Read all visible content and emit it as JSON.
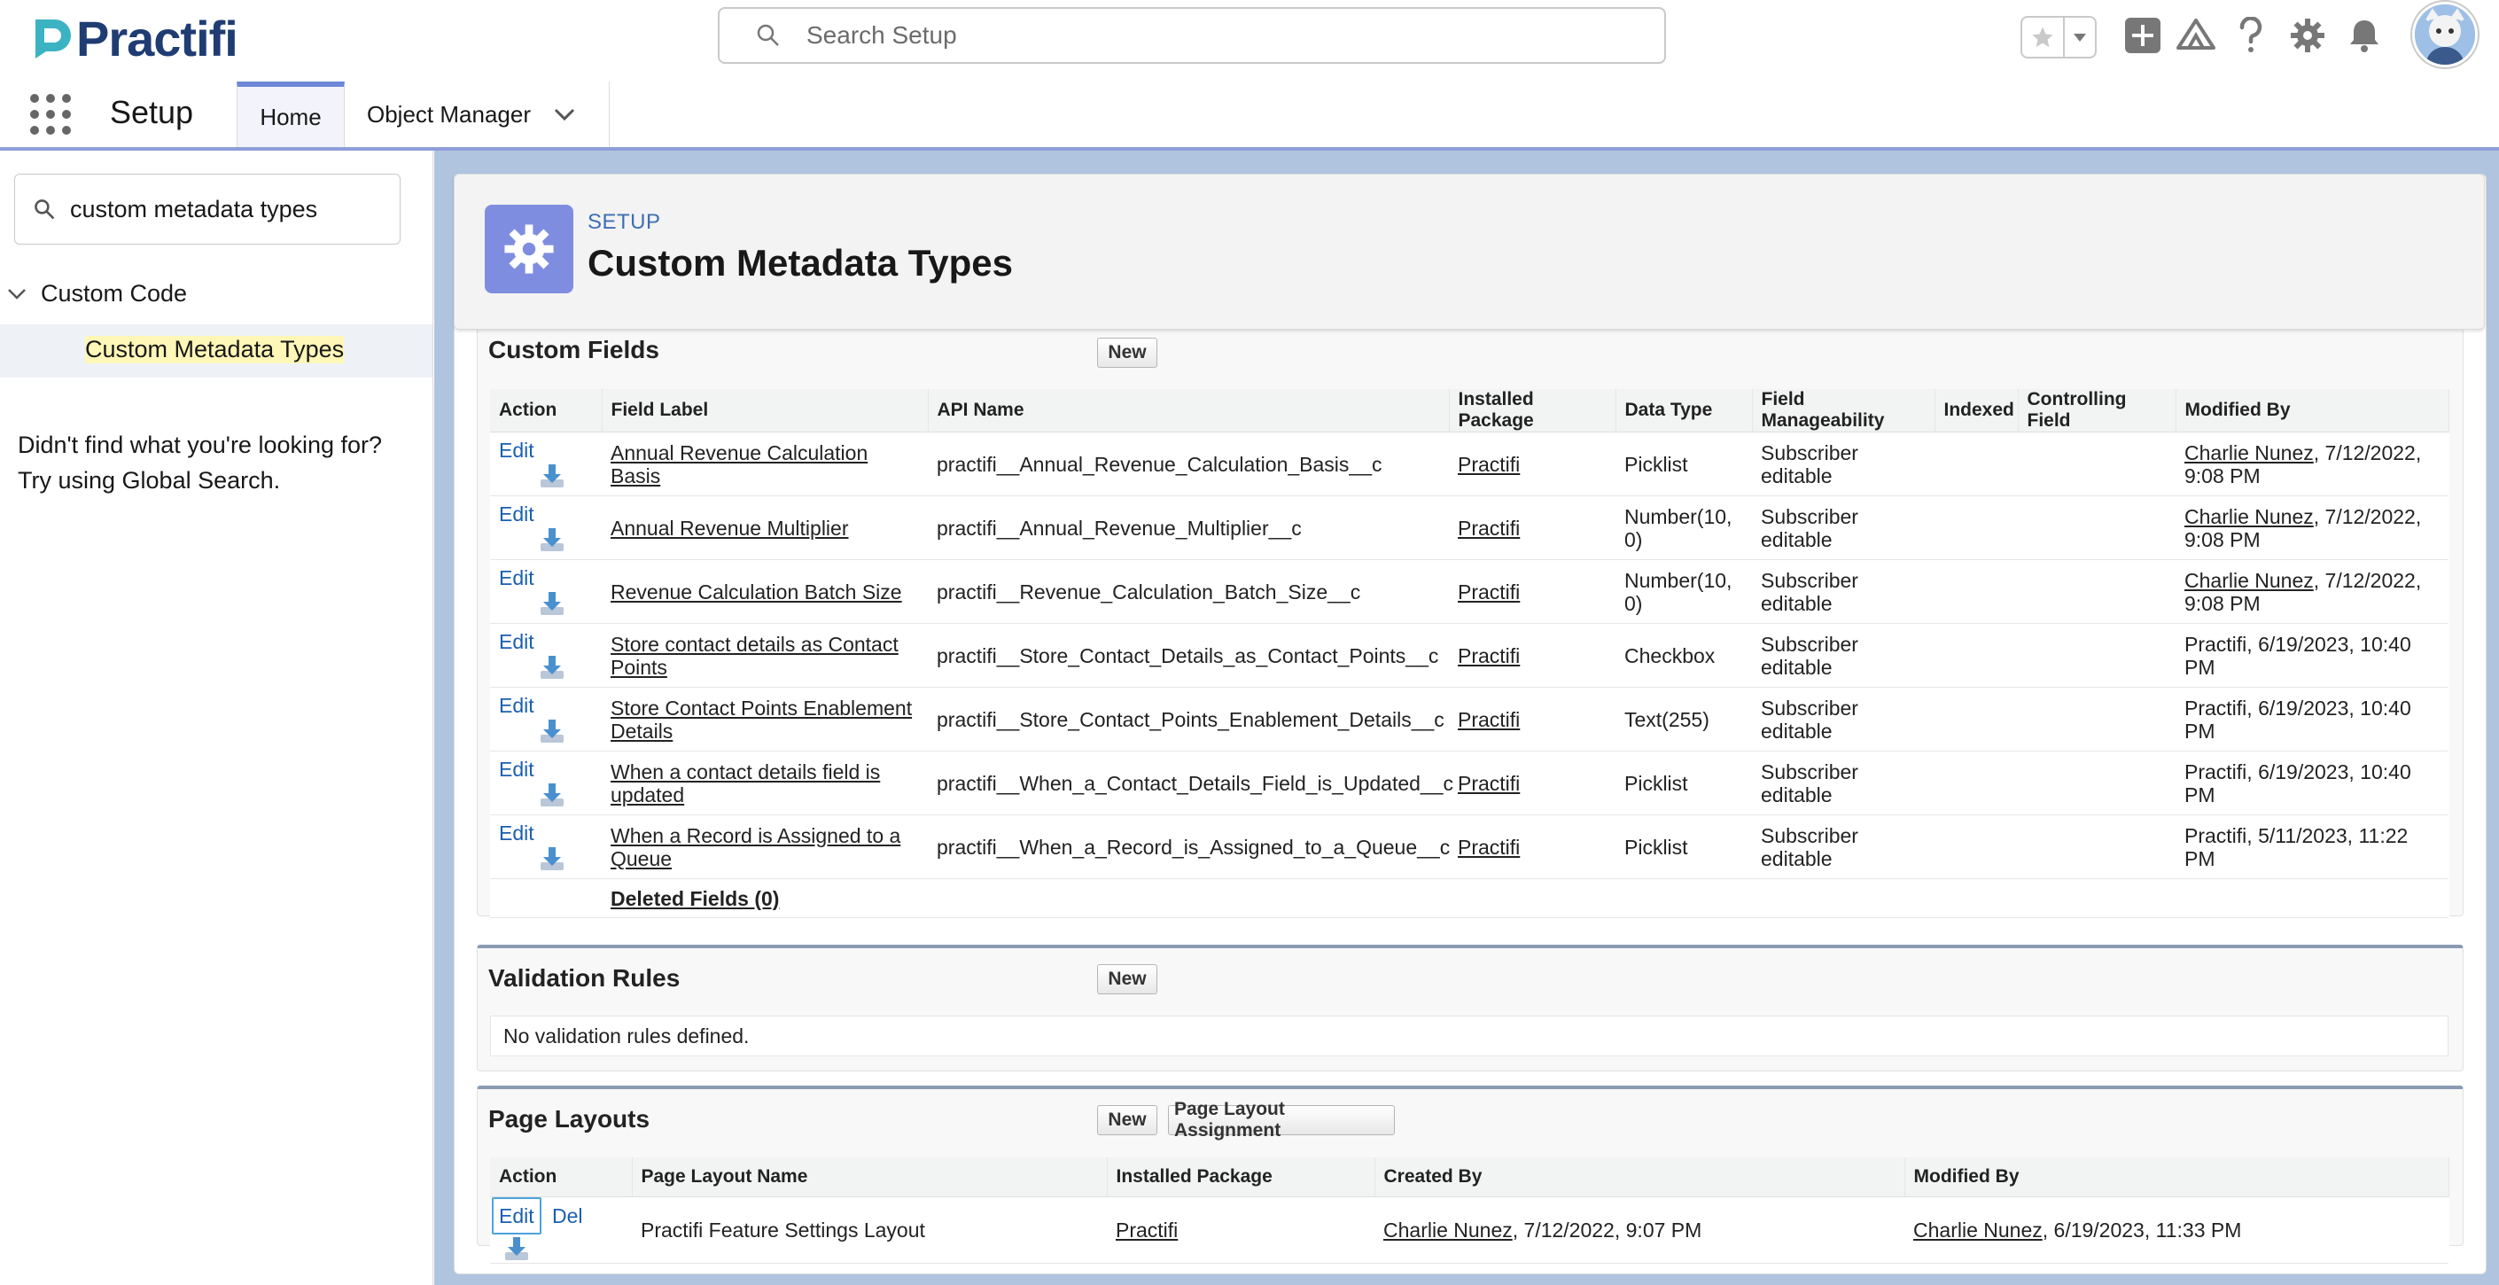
{
  "header": {
    "brand": "Practifi",
    "search_placeholder": "Search Setup"
  },
  "nav": {
    "app_name": "Setup",
    "tabs": [
      {
        "label": "Home"
      },
      {
        "label": "Object Manager"
      }
    ]
  },
  "sidebar": {
    "quick_find_value": "custom metadata types",
    "tree_parent": "Custom Code",
    "tree_child": "Custom Metadata Types",
    "help_text": "Didn't find what you're looking for? Try using Global Search."
  },
  "page_header": {
    "breadcrumb": "SETUP",
    "title": "Custom Metadata Types"
  },
  "custom_fields": {
    "partial_title": "Custom Fields",
    "new_label": "New",
    "columns": [
      "Action",
      "Field Label",
      "API Name",
      "Installed Package",
      "Data Type",
      "Field Manageability",
      "Indexed",
      "Controlling Field",
      "Modified By"
    ],
    "rows": [
      {
        "edit": "Edit",
        "label": "Annual Revenue Calculation Basis",
        "api": "practifi__Annual_Revenue_Calculation_Basis__c",
        "pkg": "Practifi",
        "type": "Picklist",
        "manage": "Subscriber editable",
        "mod_user": "Charlie Nunez",
        "mod_date": ", 7/12/2022, 9:08 PM"
      },
      {
        "edit": "Edit",
        "label": "Annual Revenue Multiplier",
        "api": "practifi__Annual_Revenue_Multiplier__c",
        "pkg": "Practifi",
        "type": "Number(10, 0)",
        "manage": "Subscriber editable",
        "mod_user": "Charlie Nunez",
        "mod_date": ", 7/12/2022, 9:08 PM"
      },
      {
        "edit": "Edit",
        "label": "Revenue Calculation Batch Size",
        "api": "practifi__Revenue_Calculation_Batch_Size__c",
        "pkg": "Practifi",
        "type": "Number(10, 0)",
        "manage": "Subscriber editable",
        "mod_user": "Charlie Nunez",
        "mod_date": ", 7/12/2022, 9:08 PM"
      },
      {
        "edit": "Edit",
        "label": "Store contact details as Contact Points",
        "api": "practifi__Store_Contact_Details_as_Contact_Points__c",
        "pkg": "Practifi",
        "type": "Checkbox",
        "manage": "Subscriber editable",
        "mod_user": "",
        "mod_date": "Practifi, 6/19/2023, 10:40 PM"
      },
      {
        "edit": "Edit",
        "label": "Store Contact Points Enablement Details",
        "api": "practifi__Store_Contact_Points_Enablement_Details__c",
        "pkg": "Practifi",
        "type": "Text(255)",
        "manage": "Subscriber editable",
        "mod_user": "",
        "mod_date": "Practifi, 6/19/2023, 10:40 PM"
      },
      {
        "edit": "Edit",
        "label": "When a contact details field is updated",
        "api": "practifi__When_a_Contact_Details_Field_is_Updated__c",
        "pkg": "Practifi",
        "type": "Picklist",
        "manage": "Subscriber editable",
        "mod_user": "",
        "mod_date": "Practifi, 6/19/2023, 10:40 PM"
      },
      {
        "edit": "Edit",
        "label": "When a Record is Assigned to a Queue",
        "api": "practifi__When_a_Record_is_Assigned_to_a_Queue__c",
        "pkg": "Practifi",
        "type": "Picklist",
        "manage": "Subscriber editable",
        "mod_user": "",
        "mod_date": "Practifi, 5/11/2023, 11:22 PM"
      }
    ],
    "deleted_link": "Deleted Fields (0)"
  },
  "validation_rules": {
    "title": "Validation Rules",
    "new_label": "New",
    "empty_text": "No validation rules defined."
  },
  "page_layouts": {
    "title": "Page Layouts",
    "new_label": "New",
    "assignment_label": "Page Layout Assignment",
    "columns": [
      "Action",
      "Page Layout Name",
      "Installed Package",
      "Created By",
      "Modified By"
    ],
    "rows": [
      {
        "edit": "Edit",
        "del": "Del",
        "name": "Practifi Feature Settings Layout",
        "pkg": "Practifi",
        "created_user": "Charlie Nunez",
        "created_date": ", 7/12/2022, 9:07 PM",
        "mod_user": "Charlie Nunez",
        "mod_date": ", 6/19/2023, 11:33 PM"
      }
    ]
  },
  "colors": {
    "brand": "#1f3c73",
    "link": "#1a5fb0",
    "setup_icon": "#7f8de1",
    "main_background": "#b0c4df"
  }
}
